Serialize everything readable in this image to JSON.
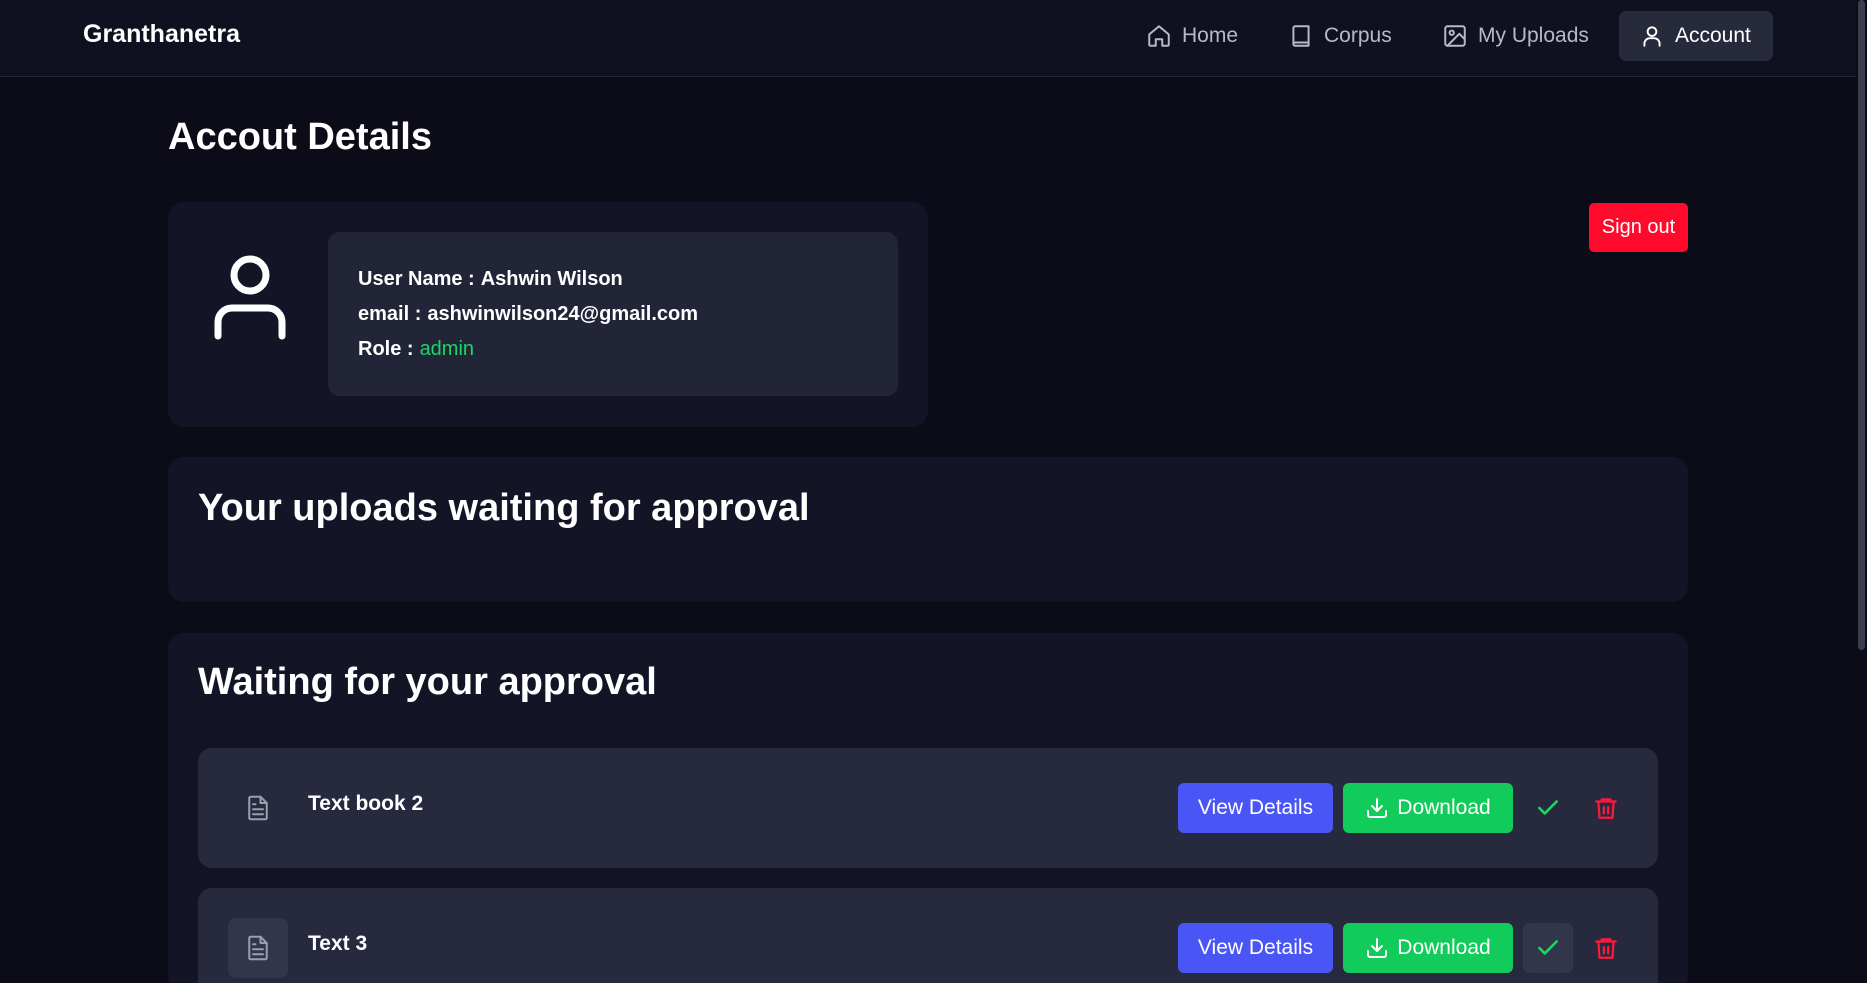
{
  "navbar": {
    "brand": "Granthanetra",
    "items": [
      {
        "label": "Home",
        "icon": "home-icon"
      },
      {
        "label": "Corpus",
        "icon": "book-icon"
      },
      {
        "label": "My Uploads",
        "icon": "image-icon"
      },
      {
        "label": "Account",
        "icon": "user-icon",
        "active": true
      }
    ]
  },
  "page": {
    "title": "Accout Details",
    "signout_label": "Sign out"
  },
  "profile": {
    "username_label": "User Name :",
    "username": "Ashwin Wilson",
    "email_label": "email :",
    "email": "ashwinwilson24@gmail.com",
    "role_label": "Role :",
    "role": "admin"
  },
  "uploads_section": {
    "title": "Your uploads waiting for approval"
  },
  "approval_section": {
    "title": "Waiting for your approval",
    "items": [
      {
        "title": "Text book 2",
        "view_label": "View Details",
        "download_label": "Download"
      },
      {
        "title": "Text 3",
        "view_label": "View Details",
        "download_label": "Download"
      }
    ]
  },
  "colors": {
    "background": "#0b0c17",
    "card": "#131527",
    "view_button": "#4a55f6",
    "download_button": "#11cc5a",
    "signout_button": "#ff0a2b",
    "role_text": "#1fd562",
    "delete_icon": "#ff1a3a",
    "approve_icon": "#1fd562"
  }
}
